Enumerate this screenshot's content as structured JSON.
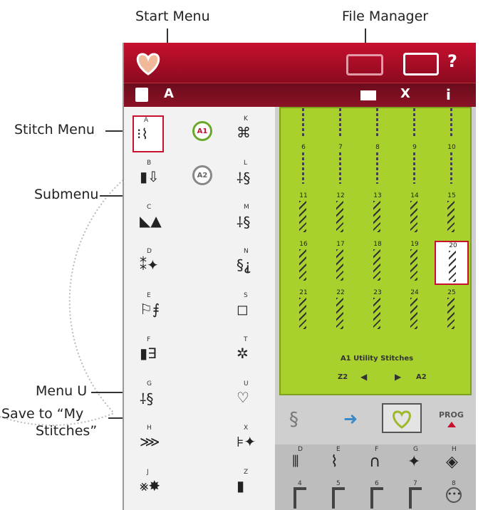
{
  "callouts": {
    "start_menu": "Start Menu",
    "file_manager": "File Manager",
    "stitch_menu": "Stitch Menu",
    "submenu": "Submenu",
    "menu_u": "Menu U",
    "save_line1": "Save to “My",
    "save_line2": "Stitches”"
  },
  "topbar": {
    "help": "?"
  },
  "toolbar": {
    "info": "i"
  },
  "left_menu": {
    "items": [
      {
        "letter": "A",
        "icon": "straight-stitch-icon"
      },
      {
        "letter": "A1",
        "icon": "submenu-a1-icon"
      },
      {
        "letter": "K",
        "icon": "k-icon"
      },
      {
        "letter": "B",
        "icon": "b-icon"
      },
      {
        "letter": "A2",
        "icon": "submenu-a2-icon"
      },
      {
        "letter": "L",
        "icon": "l-icon"
      },
      {
        "letter": "C",
        "icon": "c-icon"
      },
      {
        "letter": "M",
        "icon": "m-icon"
      },
      {
        "letter": "D",
        "icon": "d-icon"
      },
      {
        "letter": "N",
        "icon": "n-icon"
      },
      {
        "letter": "E",
        "icon": "e-icon"
      },
      {
        "letter": "S",
        "icon": "s-icon"
      },
      {
        "letter": "F",
        "icon": "f-icon"
      },
      {
        "letter": "T",
        "icon": "t-icon"
      },
      {
        "letter": "G",
        "icon": "g-icon"
      },
      {
        "letter": "U",
        "icon": "heart-outline-icon"
      },
      {
        "letter": "H",
        "icon": "h-icon"
      },
      {
        "letter": "X",
        "icon": "x-icon"
      },
      {
        "letter": "J",
        "icon": "j-icon"
      },
      {
        "letter": "Z",
        "icon": "z-icon"
      }
    ]
  },
  "stitch_grid": {
    "numbers": [
      "6",
      "7",
      "8",
      "9",
      "10",
      "11",
      "12",
      "13",
      "14",
      "15",
      "16",
      "17",
      "18",
      "19",
      "20",
      "21",
      "22",
      "23",
      "24",
      "25"
    ],
    "selected": "20",
    "menu_title": "A1 Utility Stitches",
    "nav_left": "Z2",
    "nav_right": "A2"
  },
  "actions": {
    "prog": "PROG"
  },
  "bottom_strip": {
    "letters": [
      "D",
      "E",
      "F",
      "G",
      "H"
    ],
    "numbers": [
      "4",
      "5",
      "6",
      "7",
      "8"
    ]
  },
  "colors": {
    "accent": "#c8102e",
    "green": "#a9d12d"
  }
}
